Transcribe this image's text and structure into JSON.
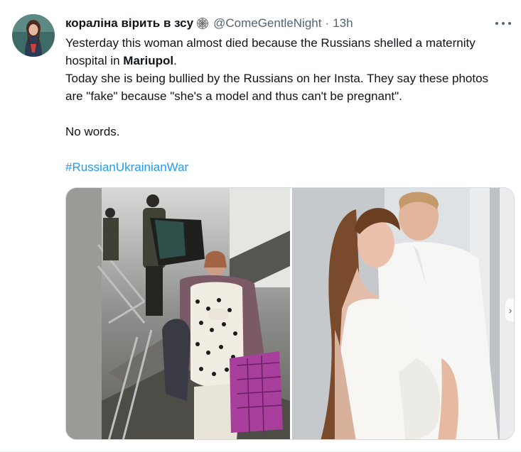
{
  "tweet": {
    "display_name": "кораліна вірить в зсу",
    "handle": "@ComeGentleNight",
    "separator": "·",
    "time": "13h",
    "text_line1_pre": "Yesterday this woman almost died because the Russians shelled a maternity hospital in ",
    "text_line1_bold": "Mariupol",
    "text_line1_post": ".",
    "text_line2": "Today she is being bullied by the Russians on her Insta. They say these photos are \"fake\" because \"she's a model and thus can't be pregnant\".",
    "text_line3": "No words.",
    "hashtag": "#RussianUkrainianWar"
  },
  "icons": {
    "more": "more-horizontal-icon",
    "name_badge": "spider-web-icon",
    "next": "chevron-right-icon"
  },
  "media": {
    "photos": [
      {
        "name": "hospital-stairs-photo"
      },
      {
        "name": "couple-maternity-photo"
      }
    ]
  },
  "colors": {
    "link": "#1d9bf0",
    "secondary_text": "#536471",
    "border": "#cfd9de"
  }
}
